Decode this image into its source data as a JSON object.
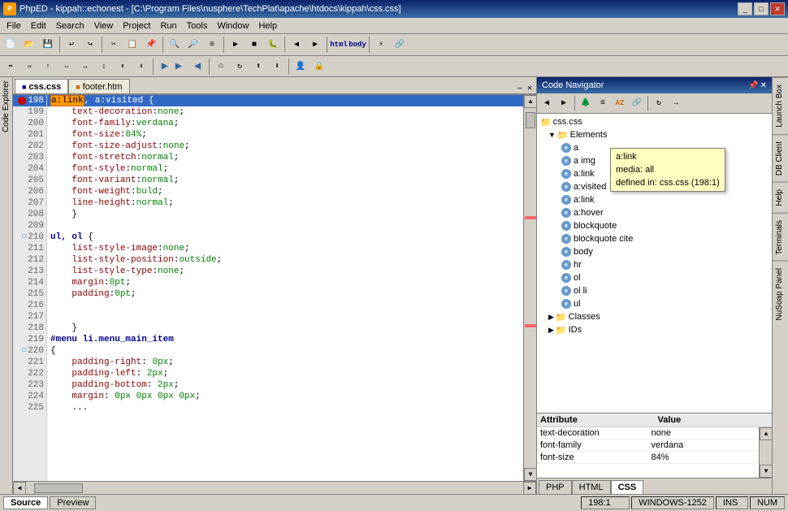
{
  "titleBar": {
    "title": "PhpED - kippah::echonest - [C:\\Program Files\\nusphere\\TechPlat\\apache\\htdocs\\kippah\\css.css]",
    "iconLabel": "P"
  },
  "menuBar": {
    "items": [
      "File",
      "Edit",
      "Search",
      "View",
      "Project",
      "Run",
      "Tools",
      "Window",
      "Help"
    ]
  },
  "tabs": {
    "items": [
      {
        "label": "css.css",
        "active": true
      },
      {
        "label": "footer.htm",
        "active": false
      }
    ]
  },
  "editor": {
    "lines": [
      {
        "num": "198",
        "content": "a:link, a:visited {",
        "type": "selector",
        "highlighted": true,
        "icon": "breakpoint"
      },
      {
        "num": "199",
        "content": "    text-decoration:none;",
        "type": "property"
      },
      {
        "num": "200",
        "content": "    font-family:verdana;",
        "type": "property"
      },
      {
        "num": "201",
        "content": "    font-size:84%;",
        "type": "property"
      },
      {
        "num": "202",
        "content": "    font-size-adjust:none;",
        "type": "property"
      },
      {
        "num": "203",
        "content": "    font-stretch:normal;",
        "type": "property"
      },
      {
        "num": "204",
        "content": "    font-style:normal;",
        "type": "property"
      },
      {
        "num": "205",
        "content": "    font-variant:normal;",
        "type": "property"
      },
      {
        "num": "206",
        "content": "    font-weight:buld;",
        "type": "property"
      },
      {
        "num": "207",
        "content": "    line-height:normal;",
        "type": "property"
      },
      {
        "num": "208",
        "content": "}",
        "type": "brace"
      },
      {
        "num": "209",
        "content": "",
        "type": "empty"
      },
      {
        "num": "210",
        "content": "ul, ol {",
        "type": "selector"
      },
      {
        "num": "211",
        "content": "    list-style-image:none;",
        "type": "property"
      },
      {
        "num": "212",
        "content": "    list-style-position:outside;",
        "type": "property"
      },
      {
        "num": "213",
        "content": "    list-style-type:none;",
        "type": "property"
      },
      {
        "num": "214",
        "content": "    margin:0pt;",
        "type": "property"
      },
      {
        "num": "215",
        "content": "    padding:0pt;",
        "type": "property"
      },
      {
        "num": "216",
        "content": "",
        "type": "empty"
      },
      {
        "num": "217",
        "content": "",
        "type": "empty"
      },
      {
        "num": "218",
        "content": "}",
        "type": "brace"
      },
      {
        "num": "219",
        "content": "#menu li.menu_main_item",
        "type": "selector"
      },
      {
        "num": "220",
        "content": "{",
        "type": "brace"
      },
      {
        "num": "221",
        "content": "    padding-right: 0px;",
        "type": "property"
      },
      {
        "num": "222",
        "content": "    padding-left: 2px;",
        "type": "property"
      },
      {
        "num": "223",
        "content": "    padding-bottom: 2px;",
        "type": "property"
      },
      {
        "num": "224",
        "content": "    margin: 0px 0px 0px 0px;",
        "type": "property"
      },
      {
        "num": "225",
        "content": "    ...",
        "type": "property"
      }
    ]
  },
  "codeNavigator": {
    "title": "Code Navigator",
    "filename": "css.css",
    "tree": {
      "root": "css.css",
      "elements": {
        "label": "Elements",
        "items": [
          "a",
          "a img",
          "a:link",
          "a:visited",
          "a:link",
          "a:hover",
          "blockquote",
          "blockquote cite",
          "body",
          "hr",
          "ol",
          "ol li",
          "ul"
        ]
      },
      "classes": {
        "label": "Classes"
      },
      "ids": {
        "label": "IDs"
      }
    },
    "tooltip": {
      "visible": true,
      "lines": [
        "a:link",
        "media: all",
        "defined in: css.css (198:1)"
      ]
    }
  },
  "attributePanel": {
    "columns": [
      "Attribute",
      "Value"
    ],
    "rows": [
      {
        "attr": "text-decoration",
        "value": "none"
      },
      {
        "attr": "font-family",
        "value": "verdana"
      },
      {
        "attr": "font-size",
        "value": "84%"
      }
    ]
  },
  "bottomTabs": {
    "items": [
      "PHP",
      "HTML",
      "CSS"
    ],
    "active": "CSS"
  },
  "statusBar": {
    "tabs": [
      {
        "label": "Source",
        "active": true
      },
      {
        "label": "Preview",
        "active": false
      }
    ],
    "position": "198:1",
    "encoding": "WINDOWS-1252",
    "mode": "INS",
    "numlock": "NUM"
  },
  "rightSideTabs": [
    "Launch Box",
    "DB Client",
    "Help",
    "Terminals",
    "NuSoap Panel"
  ],
  "icons": {
    "folder": "📁",
    "element": "●",
    "breakpoint": "■",
    "arrow_right": "▶",
    "arrow_left": "◀",
    "arrow_up": "▲",
    "arrow_down": "▼",
    "close": "✕",
    "minimize": "_",
    "maximize": "□",
    "restore": "❐"
  }
}
